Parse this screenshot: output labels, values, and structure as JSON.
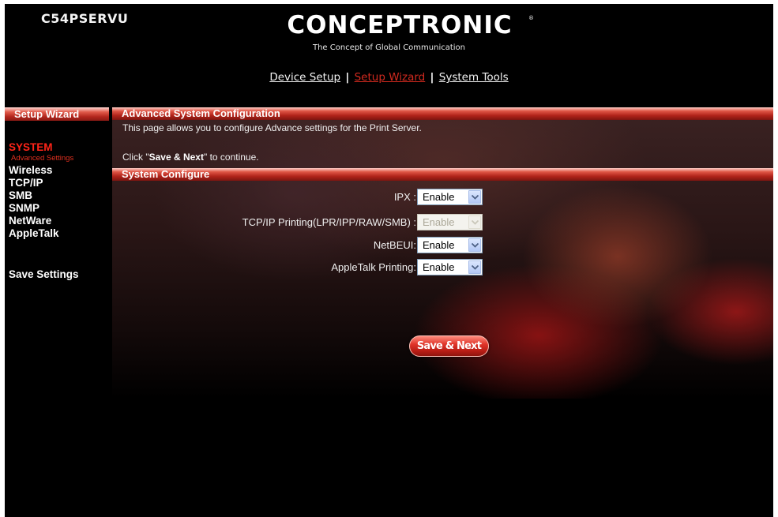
{
  "header": {
    "model": "C54PSERVU",
    "brand": "CONCEPTRONIC",
    "tagline": "The Concept of Global Communication",
    "nav": [
      {
        "label": "Device Setup",
        "active": false
      },
      {
        "label": "Setup Wizard",
        "active": true
      },
      {
        "label": "System Tools",
        "active": false
      }
    ],
    "nav_separator": "|"
  },
  "sidebar": {
    "title": "Setup Wizard",
    "items": [
      {
        "label": "SYSTEM",
        "active": true
      },
      {
        "label": "Advanced Settings",
        "sub": true
      },
      {
        "label": "Wireless"
      },
      {
        "label": "TCP/IP"
      },
      {
        "label": "SMB"
      },
      {
        "label": "SNMP"
      },
      {
        "label": "NetWare"
      },
      {
        "label": "AppleTalk"
      },
      {
        "label": "Save Settings"
      }
    ]
  },
  "main": {
    "section_title": "Advanced System Configuration",
    "description": "This page allows you to configure Advance settings for the Print Server.",
    "instruction_prefix": "Click \"",
    "instruction_bold": "Save & Next",
    "instruction_suffix": "\" to continue.",
    "config_title": "System Configure",
    "fields": [
      {
        "label": "IPX :",
        "value": "Enable",
        "disabled": false
      },
      {
        "label": "TCP/IP Printing(LPR/IPP/RAW/SMB) :",
        "value": "Enable",
        "disabled": true
      },
      {
        "label": "NetBEUI:",
        "value": "Enable",
        "disabled": false
      },
      {
        "label": "AppleTalk Printing:",
        "value": "Enable",
        "disabled": false
      }
    ],
    "save_button": "Save & Next"
  },
  "colors": {
    "accent_red": "#d22a1f",
    "active_red": "#ff2418",
    "background": "#000000"
  }
}
